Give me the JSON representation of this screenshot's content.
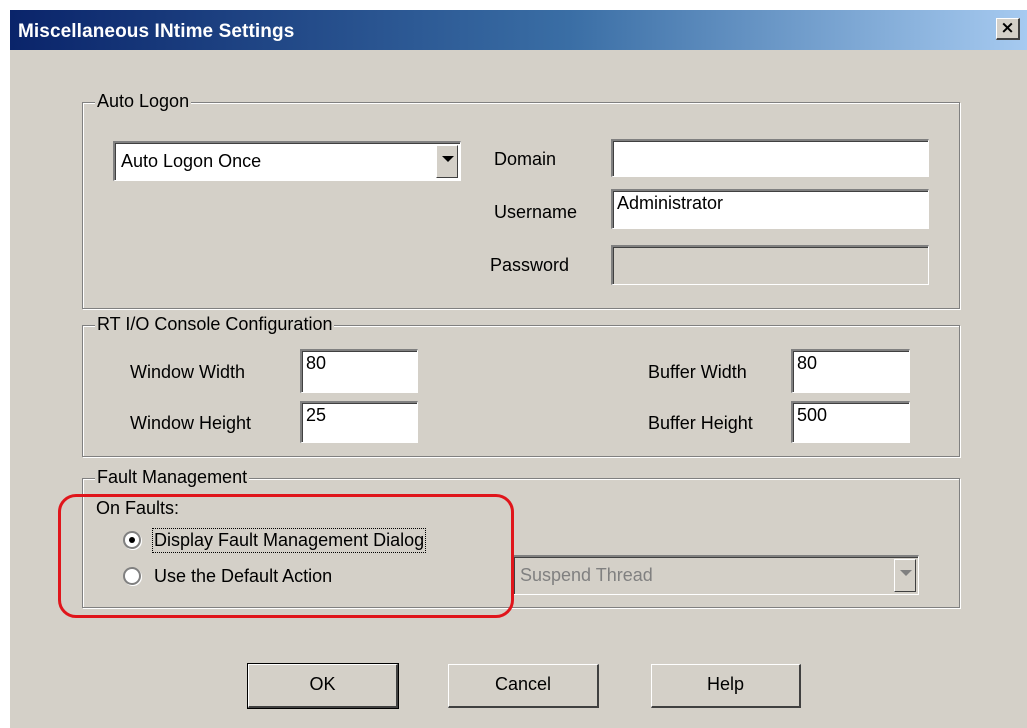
{
  "window": {
    "title": "Miscellaneous INtime Settings",
    "close_label": "×"
  },
  "auto_logon": {
    "legend": "Auto Logon",
    "mode_value": "Auto Logon Once",
    "domain_label": "Domain",
    "domain_value": "",
    "username_label": "Username",
    "username_value": "Administrator",
    "password_label": "Password",
    "password_value": ""
  },
  "console": {
    "legend": "RT I/O Console Configuration",
    "window_width_label": "Window Width",
    "window_width_value": "80",
    "window_height_label": "Window Height",
    "window_height_value": "25",
    "buffer_width_label": "Buffer Width",
    "buffer_width_value": "80",
    "buffer_height_label": "Buffer Height",
    "buffer_height_value": "500"
  },
  "fault": {
    "legend": "Fault Management",
    "on_faults_label": "On Faults:",
    "option_display": "Display Fault Management Dialog",
    "option_default": "Use the Default Action",
    "selected_option": "Display Fault Management Dialog",
    "default_action_value": "Suspend Thread"
  },
  "buttons": {
    "ok": "OK",
    "cancel": "Cancel",
    "help": "Help"
  },
  "colors": {
    "title_bar": "#0a246a",
    "dialog_bg": "#d4d0c8",
    "highlight": "#e0151b"
  }
}
